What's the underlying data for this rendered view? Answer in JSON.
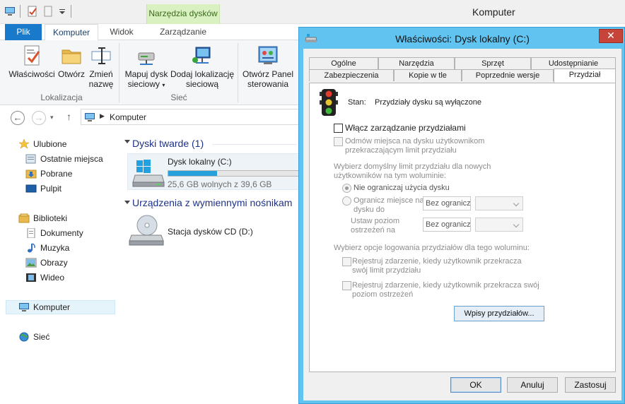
{
  "explorer": {
    "title": "Komputer",
    "contextual_tab_header": "Narzędzia dysków",
    "ribbon_tabs": [
      {
        "label": "Plik"
      },
      {
        "label": "Komputer"
      },
      {
        "label": "Widok"
      },
      {
        "label": "Zarządzanie"
      }
    ],
    "ribbon": {
      "location_group": {
        "label": "Lokalizacja",
        "buttons": [
          {
            "line1": "Właściwości",
            "line2": ""
          },
          {
            "line1": "Otwórz",
            "line2": ""
          },
          {
            "line1": "Zmień",
            "line2": "nazwę"
          }
        ]
      },
      "network_group": {
        "label": "Sieć",
        "buttons": [
          {
            "line1": "Mapuj dysk",
            "line2": "sieciowy"
          },
          {
            "line1": "Dodaj lokalizację",
            "line2": "sieciową"
          }
        ]
      },
      "system_buttons": [
        {
          "line1": "Otwórz Panel",
          "line2": "sterowania"
        }
      ]
    },
    "address": {
      "path": "Komputer"
    },
    "nav_pane": {
      "favorites": {
        "label": "Ulubione",
        "items": [
          "Ostatnie miejsca",
          "Pobrane",
          "Pulpit"
        ]
      },
      "libraries": {
        "label": "Biblioteki",
        "items": [
          "Dokumenty",
          "Muzyka",
          "Obrazy",
          "Wideo"
        ]
      },
      "computer": "Komputer",
      "network": "Sieć"
    },
    "content": {
      "hard_drives_header": "Dyski twarde (1)",
      "local_disk": {
        "name": "Dysk lokalny (C:)",
        "free_text": "25,6 GB wolnych z 39,6 GB",
        "used_fraction": 0.354
      },
      "removable_header": "Urządzenia z wymiennymi nośnikam",
      "cd_drive": {
        "name": "Stacja dysków CD (D:)"
      }
    }
  },
  "dialog": {
    "title": "Właściwości: Dysk lokalny (C:)",
    "close_glyph": "✕",
    "tabs_row1": [
      "Ogólne",
      "Narzędzia",
      "Sprzęt",
      "Udostępnianie"
    ],
    "tabs_row2": [
      "Zabezpieczenia",
      "Kopie w tle",
      "Poprzednie wersje",
      "Przydział"
    ],
    "status_label": "Stan:",
    "status_value": "Przydziały dysku są wyłączone",
    "enable_quota": "Włącz zarządzanie przydziałami",
    "deny_space_line1": "Odmów miejsca na dysku użytkownikom",
    "deny_space_line2": "przekraczającym limit przydziału",
    "default_limit_line1": "Wybierz domyślny limit przydziału dla nowych",
    "default_limit_line2": "użytkowników na tym woluminie:",
    "no_limit": "Nie ograniczaj użycia dysku",
    "limit_line1": "Ogranicz miejsce na",
    "limit_line2": "dysku do",
    "limit_value": "Bez ograniczeń",
    "warning_line1": "Ustaw poziom",
    "warning_line2": "ostrzeżeń na",
    "warning_value": "Bez ograniczeń",
    "logging_header": "Wybierz opcje logowania przydziałów dla tego woluminu:",
    "log_exceed_limit_line1": "Rejestruj zdarzenie, kiedy użytkownik przekracza",
    "log_exceed_limit_line2": "swój limit przydziału",
    "log_exceed_warning_line1": "Rejestruj zdarzenie, kiedy użytkownik przekracza swój",
    "log_exceed_warning_line2": "poziom ostrzeżeń",
    "quota_entries_button": "Wpisy przydziałów...",
    "ok": "OK",
    "cancel": "Anuluj",
    "apply": "Zastosuj"
  }
}
